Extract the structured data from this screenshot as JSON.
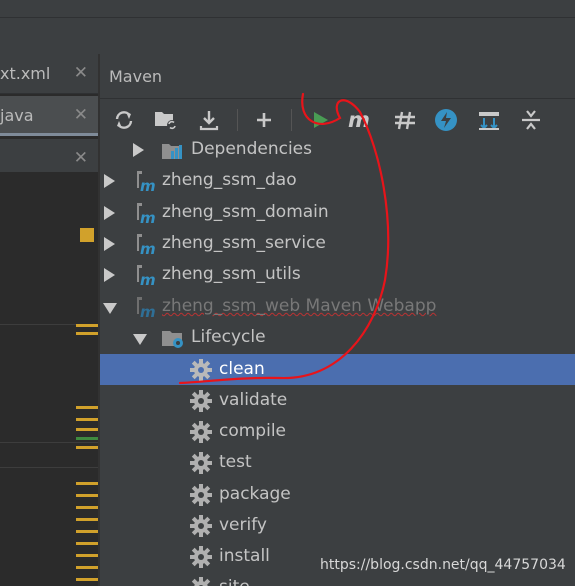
{
  "editor": {
    "tabs": [
      {
        "label": "xt.xml",
        "close": "✕"
      },
      {
        "label": "java",
        "close": "✕"
      },
      {
        "label": "",
        "close": "✕"
      },
      {
        "label": "",
        "close": "✕"
      }
    ]
  },
  "maven": {
    "title": "Maven",
    "toolbar": [
      {
        "name": "reimport-icon"
      },
      {
        "name": "generate-sources-icon"
      },
      {
        "name": "download-icon"
      },
      {
        "name": "add-icon"
      },
      {
        "name": "run-icon"
      },
      {
        "name": "execute-goal-icon"
      },
      {
        "name": "toggle-offline-icon"
      },
      {
        "name": "skip-tests-icon"
      },
      {
        "name": "show-dependencies-icon"
      },
      {
        "name": "collapse-all-icon"
      }
    ],
    "tree": {
      "dependencies": "Dependencies",
      "modules": [
        "zheng_ssm_dao",
        "zheng_ssm_domain",
        "zheng_ssm_service",
        "zheng_ssm_utils"
      ],
      "webapp": "zheng_ssm_web Maven Webapp",
      "lifecycle": "Lifecycle",
      "goals": [
        "clean",
        "validate",
        "compile",
        "test",
        "package",
        "verify",
        "install",
        "site"
      ],
      "selected_goal": "clean"
    }
  },
  "watermark": "https://blog.csdn.net/qq_44757034",
  "colors": {
    "selection": "#4b6eaf",
    "run": "#499c54",
    "annotation": "#e8141a"
  }
}
